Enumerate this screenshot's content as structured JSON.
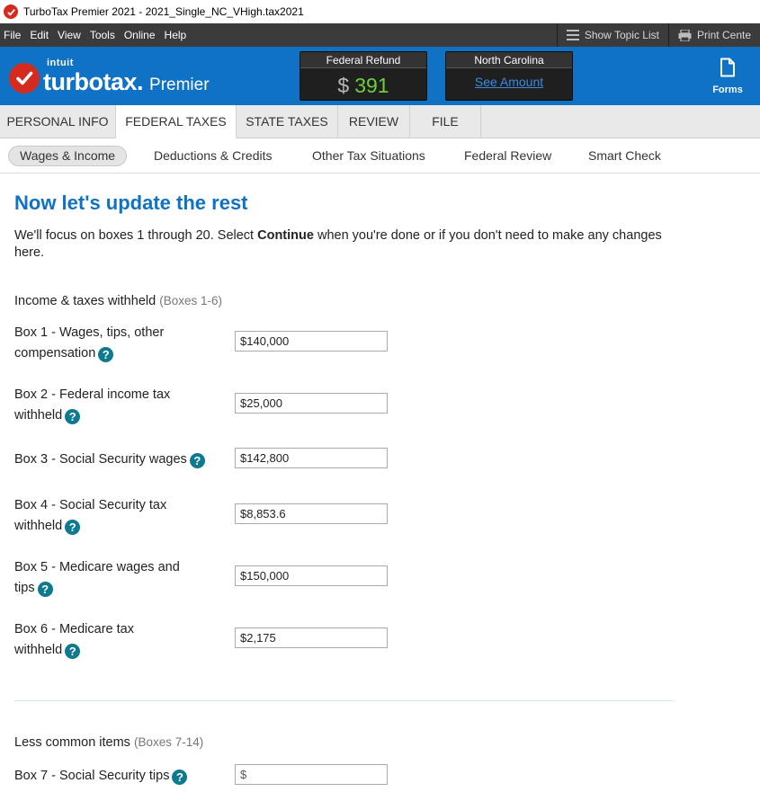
{
  "window": {
    "title": "TurboTax Premier 2021 - 2021_Single_NC_VHigh.tax2021"
  },
  "menu": {
    "items": [
      "File",
      "Edit",
      "View",
      "Tools",
      "Online",
      "Help"
    ],
    "show_topic_list": "Show Topic List",
    "print_center": "Print Cente"
  },
  "brand": {
    "intuit": "intuit",
    "product": "turbotax.",
    "edition": "Premier",
    "forms_label": "Forms"
  },
  "refund": {
    "federal_label": "Federal Refund",
    "federal_currency": "$",
    "federal_amount": "391",
    "state_label": "North Carolina",
    "state_link": "See Amount"
  },
  "nav": {
    "tabs": [
      "PERSONAL INFO",
      "FEDERAL TAXES",
      "STATE TAXES",
      "REVIEW",
      "FILE"
    ],
    "active": "FEDERAL TAXES"
  },
  "subnav": {
    "tabs": [
      "Wages & Income",
      "Deductions & Credits",
      "Other Tax Situations",
      "Federal Review",
      "Smart Check"
    ],
    "active": "Wages & Income"
  },
  "page": {
    "title": "Now let's update the rest",
    "intro_before": "We'll focus on boxes 1 through 20. Select ",
    "intro_bold": "Continue",
    "intro_after": " when you're done or if you don't need to make any changes here."
  },
  "section1": {
    "title": "Income & taxes withheld",
    "sub": "(Boxes 1-6)"
  },
  "section2": {
    "title": "Less common items",
    "sub": "(Boxes 7-14)"
  },
  "boxes": [
    {
      "label": "Box 1 - Wages, tips, other compensation",
      "value": "$140,000"
    },
    {
      "label": "Box 2 - Federal income tax withheld",
      "value": "$25,000"
    },
    {
      "label": "Box 3 - Social Security wages",
      "value": "$142,800"
    },
    {
      "label": "Box 4 - Social Security tax withheld",
      "value": "$8,853.6"
    },
    {
      "label": "Box 5 - Medicare wages and tips",
      "value": "$150,000"
    },
    {
      "label": "Box 6 - Medicare tax withheld",
      "value": "$2,175"
    },
    {
      "label": "Box 7 - Social Security tips",
      "value": "",
      "placeholder": "$"
    }
  ],
  "help_glyph": "?",
  "icons": {
    "app": "turbotax-check-icon",
    "topic_list": "list-icon",
    "print": "printer-icon",
    "forms": "document-icon",
    "help": "question-circle-icon"
  },
  "colors": {
    "brand_blue": "#0f72c5",
    "brand_red": "#d52b1e",
    "refund_green": "#6fcf3a",
    "help_teal": "#0e7a8f"
  }
}
